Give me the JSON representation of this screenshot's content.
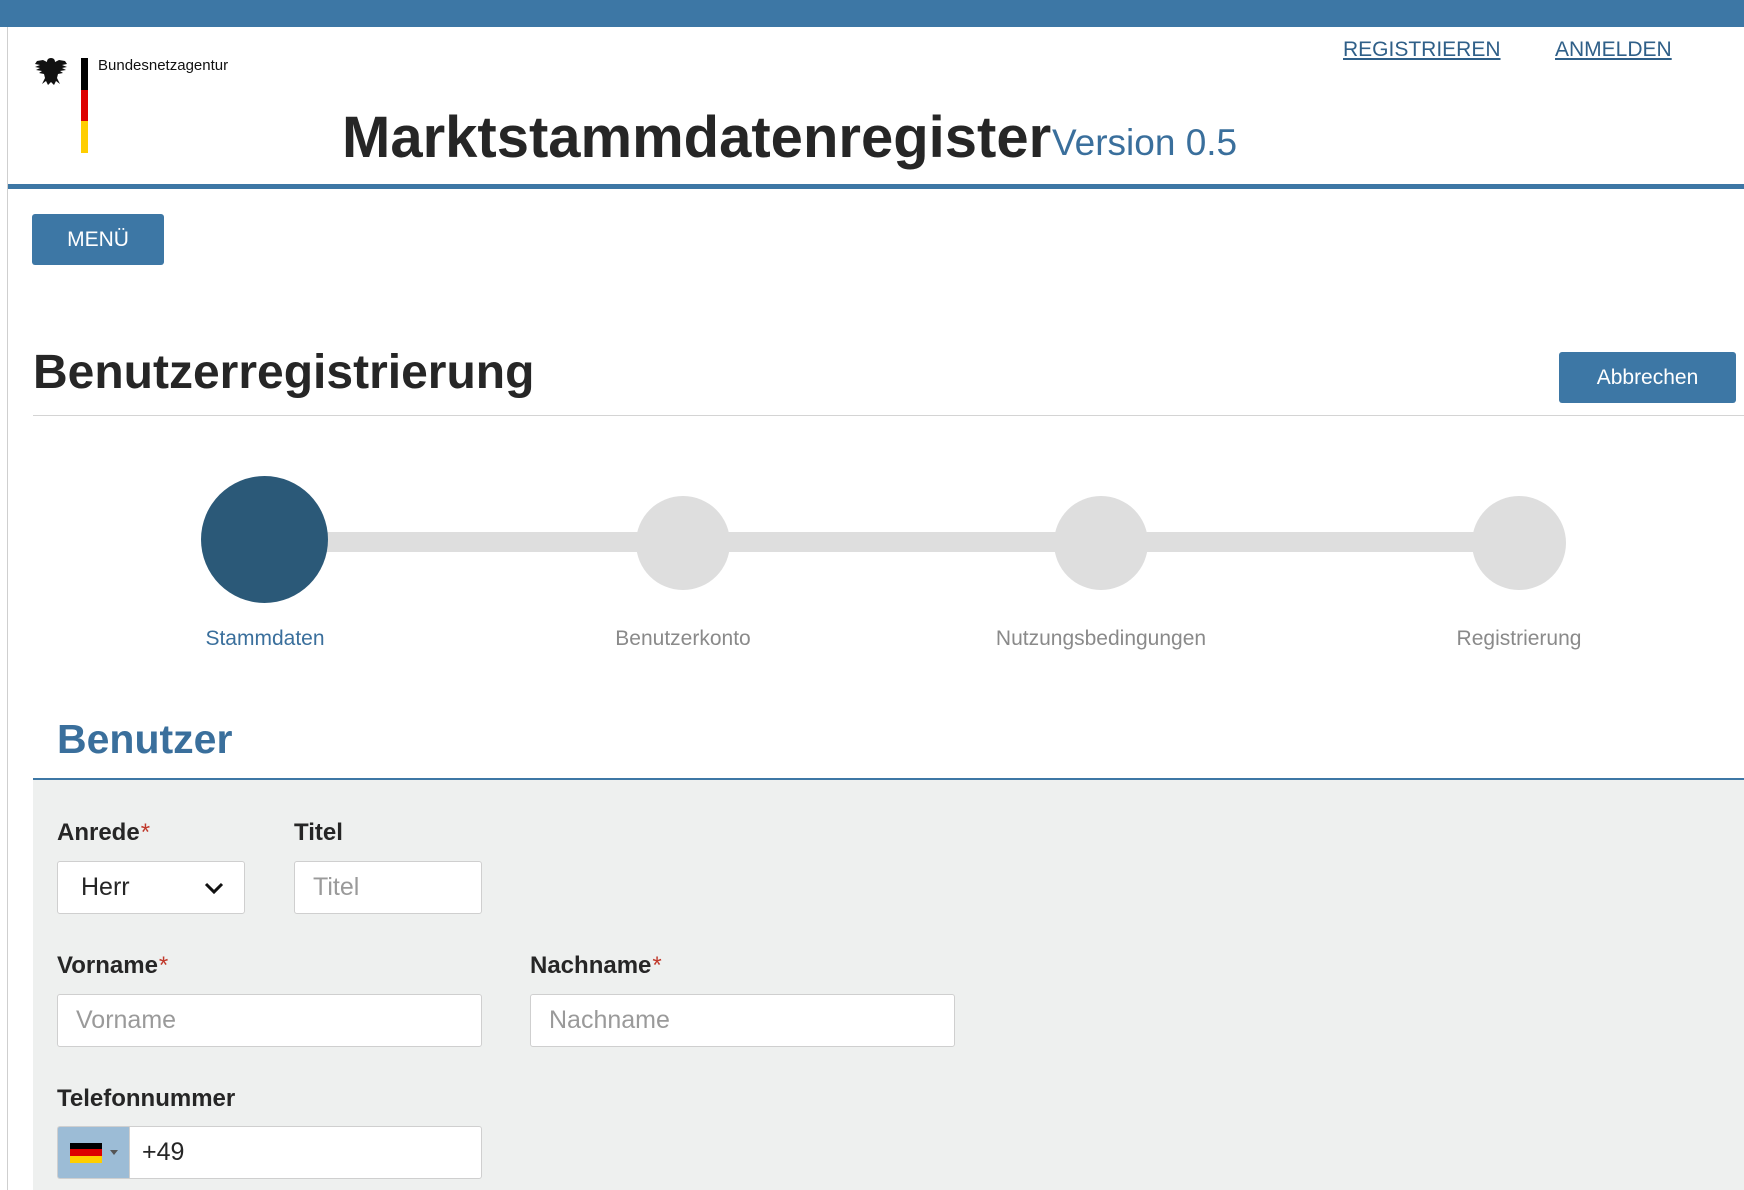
{
  "header": {
    "logo_text": "Bundesnetzagentur",
    "nav": {
      "register": "REGISTRIEREN",
      "login": "ANMELDEN"
    },
    "title": "Marktstammdatenregister",
    "version": "Version 0.5"
  },
  "menu_label": "MENÜ",
  "page": {
    "title": "Benutzerregistrierung",
    "cancel_label": "Abbrechen"
  },
  "stepper": {
    "active_step": 1,
    "steps": [
      {
        "label": "Stammdaten"
      },
      {
        "label": "Benutzerkonto"
      },
      {
        "label": "Nutzungsbedingungen"
      },
      {
        "label": "Registrierung"
      }
    ]
  },
  "form": {
    "section_title": "Benutzer",
    "required_marker": "*",
    "anrede": {
      "label": "Anrede",
      "value": "Herr"
    },
    "titel": {
      "label": "Titel",
      "placeholder": "Titel"
    },
    "vorname": {
      "label": "Vorname",
      "placeholder": "Vorname"
    },
    "nachname": {
      "label": "Nachname",
      "placeholder": "Nachname"
    },
    "telefon": {
      "label": "Telefonnummer",
      "value": "+49",
      "country_flag": "de-flag-icon"
    }
  },
  "colors": {
    "brand": "#3d77a5",
    "active_step": "#2b5978",
    "inactive_step": "#dedede",
    "form_panel": "#eef0ef",
    "required": "#c0392b"
  }
}
